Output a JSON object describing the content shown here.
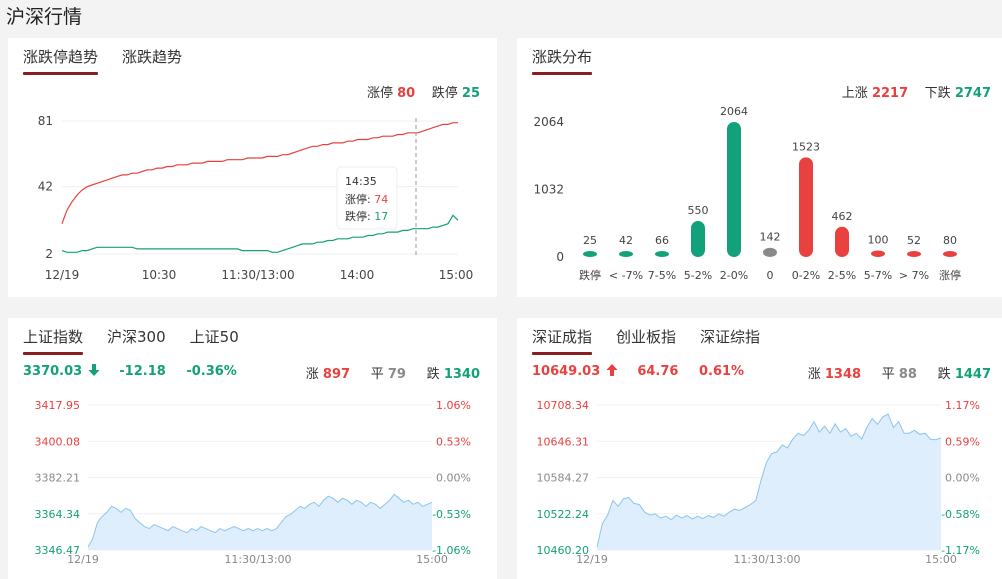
{
  "page": {
    "title": "沪深行情"
  },
  "colors": {
    "up": "#e8413f",
    "down": "#12a178",
    "flat": "#8a8a8a",
    "accent": "#8a1d22",
    "area_fill": "#deeefc",
    "area_line": "#8cc4ee"
  },
  "trend_panel": {
    "tabs": [
      {
        "label": "涨跌停趋势",
        "active": true
      },
      {
        "label": "涨跌趋势",
        "active": false
      }
    ],
    "limit_up_label": "涨停",
    "limit_up_value": "80",
    "limit_down_label": "跌停",
    "limit_down_value": "25",
    "tooltip": {
      "time": "14:35",
      "up_label": "涨停:",
      "up_value": "74",
      "down_label": "跌停:",
      "down_value": "17"
    }
  },
  "dist_panel": {
    "tabs": [
      {
        "label": "涨跌分布",
        "active": true
      }
    ],
    "up_label": "上涨",
    "up_value": "2217",
    "down_label": "下跌",
    "down_value": "2747"
  },
  "sh_panel": {
    "tabs": [
      {
        "label": "上证指数",
        "active": true
      },
      {
        "label": "沪深300",
        "active": false
      },
      {
        "label": "上证50",
        "active": false
      }
    ],
    "price": "3370.03",
    "direction": "down",
    "change": "-12.18",
    "change_pct": "-0.36%",
    "up_label": "涨",
    "up_count": "897",
    "flat_label": "平",
    "flat_count": "79",
    "down_label": "跌",
    "down_count": "1340"
  },
  "sz_panel": {
    "tabs": [
      {
        "label": "深证成指",
        "active": true
      },
      {
        "label": "创业板指",
        "active": false
      },
      {
        "label": "深证综指",
        "active": false
      }
    ],
    "price": "10649.03",
    "direction": "up",
    "change": "64.76",
    "change_pct": "0.61%",
    "up_label": "涨",
    "up_count": "1348",
    "flat_label": "平",
    "flat_count": "88",
    "down_label": "跌",
    "down_count": "1447"
  },
  "chart_data": [
    {
      "type": "line",
      "y_ticks": [
        "81",
        "42",
        "2"
      ],
      "ylim": [
        2,
        81
      ],
      "x_tick_labels": [
        "12/19",
        "10:30",
        "11:30/13:00",
        "14:00",
        "15:00"
      ],
      "grid": true,
      "crosshair_time": "14:35",
      "series": [
        {
          "name": "涨停",
          "color": "#e8413f",
          "values": [
            20,
            28,
            33,
            37,
            40,
            42,
            43,
            44,
            45,
            46,
            47,
            48,
            49,
            49,
            50,
            50,
            51,
            52,
            52,
            53,
            53,
            54,
            54,
            55,
            55,
            55,
            56,
            56,
            56,
            57,
            57,
            57,
            57,
            58,
            58,
            58,
            58,
            59,
            59,
            59,
            59,
            60,
            60,
            60,
            61,
            61,
            62,
            63,
            64,
            65,
            66,
            66,
            67,
            67,
            68,
            68,
            68,
            69,
            69,
            70,
            70,
            70,
            71,
            71,
            72,
            72,
            72,
            73,
            73,
            74,
            74,
            74,
            75,
            76,
            77,
            78,
            79,
            79,
            80,
            80
          ]
        },
        {
          "name": "跌停",
          "color": "#12a178",
          "values": [
            4,
            3,
            3,
            3,
            4,
            4,
            5,
            6,
            6,
            6,
            6,
            6,
            6,
            6,
            6,
            5,
            5,
            5,
            5,
            5,
            5,
            5,
            5,
            5,
            5,
            5,
            5,
            5,
            5,
            5,
            5,
            5,
            5,
            5,
            5,
            5,
            4,
            4,
            4,
            4,
            4,
            4,
            3,
            3,
            4,
            5,
            6,
            7,
            8,
            8,
            8,
            9,
            9,
            10,
            10,
            11,
            11,
            11,
            12,
            12,
            12,
            13,
            13,
            14,
            14,
            15,
            15,
            15,
            16,
            16,
            17,
            17,
            17,
            17,
            18,
            18,
            19,
            20,
            25,
            22
          ]
        }
      ]
    },
    {
      "type": "bar",
      "categories": [
        "跌停",
        "< -7%",
        "7-5%",
        "5-2%",
        "2-0%",
        "0",
        "0-2%",
        "2-5%",
        "5-7%",
        "> 7%",
        "涨停"
      ],
      "values": [
        25,
        42,
        66,
        550,
        2064,
        142,
        1523,
        462,
        100,
        52,
        80
      ],
      "colors": [
        "#12a178",
        "#12a178",
        "#12a178",
        "#12a178",
        "#12a178",
        "#8a8a8a",
        "#e8413f",
        "#e8413f",
        "#e8413f",
        "#e8413f",
        "#e8413f"
      ],
      "y_ticks": [
        "2064",
        "1032",
        "0"
      ],
      "ylim": [
        0,
        2064
      ]
    },
    {
      "type": "area",
      "y_ticks_left": [
        "3417.95",
        "3400.08",
        "3382.21",
        "3364.34",
        "3346.47"
      ],
      "y_ticks_right": [
        "1.06%",
        "0.53%",
        "0.00%",
        "-0.53%",
        "-1.06%"
      ],
      "ylim": [
        3346.47,
        3417.95
      ],
      "x_tick_labels": [
        "12/19",
        "11:30/13:00",
        "15:00"
      ],
      "values": [
        3348,
        3352,
        3360,
        3363,
        3365,
        3368,
        3367,
        3365,
        3367,
        3366,
        3362,
        3360,
        3358,
        3357,
        3359,
        3358,
        3357,
        3356,
        3358,
        3357,
        3356,
        3355,
        3357,
        3356,
        3358,
        3357,
        3356,
        3355,
        3357,
        3356,
        3357,
        3358,
        3357,
        3356,
        3357,
        3356,
        3357,
        3356,
        3357,
        3356,
        3357,
        3360,
        3363,
        3364,
        3366,
        3368,
        3367,
        3369,
        3370,
        3368,
        3371,
        3373,
        3372,
        3370,
        3372,
        3371,
        3369,
        3371,
        3370,
        3368,
        3370,
        3369,
        3367,
        3369,
        3371,
        3374,
        3372,
        3370,
        3371,
        3369,
        3370,
        3368,
        3369,
        3370
      ]
    },
    {
      "type": "area",
      "y_ticks_left": [
        "10708.34",
        "10646.31",
        "10584.27",
        "10522.24",
        "10460.20"
      ],
      "y_ticks_right": [
        "1.17%",
        "0.59%",
        "0.00%",
        "-0.58%",
        "-1.17%"
      ],
      "ylim": [
        10460.2,
        10708.34
      ],
      "x_tick_labels": [
        "12/19",
        "11:30/13:00",
        "15:00"
      ],
      "values": [
        10465,
        10505,
        10520,
        10545,
        10535,
        10548,
        10550,
        10540,
        10538,
        10525,
        10520,
        10522,
        10515,
        10518,
        10512,
        10520,
        10515,
        10519,
        10513,
        10518,
        10514,
        10519,
        10516,
        10522,
        10518,
        10525,
        10530,
        10528,
        10533,
        10538,
        10545,
        10580,
        10610,
        10625,
        10628,
        10640,
        10635,
        10650,
        10660,
        10656,
        10665,
        10680,
        10662,
        10672,
        10660,
        10676,
        10662,
        10668,
        10655,
        10660,
        10650,
        10670,
        10685,
        10675,
        10688,
        10693,
        10670,
        10680,
        10660,
        10660,
        10665,
        10658,
        10660,
        10650,
        10649,
        10652
      ]
    }
  ]
}
